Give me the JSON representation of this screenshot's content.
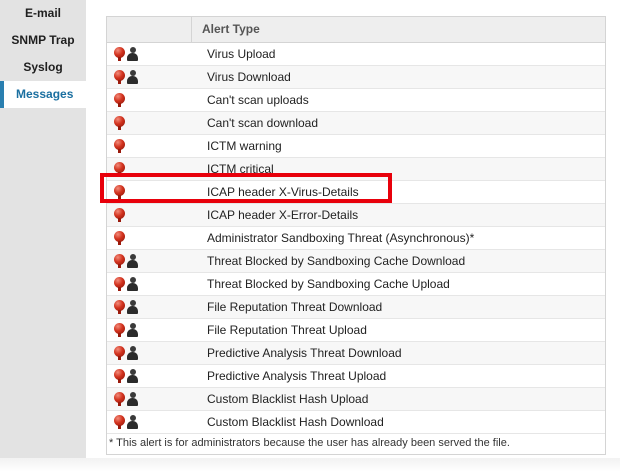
{
  "sidebar": {
    "items": [
      {
        "label": "E-mail",
        "active": false
      },
      {
        "label": "SNMP Trap",
        "active": false
      },
      {
        "label": "Syslog",
        "active": false
      },
      {
        "label": "Messages",
        "active": true
      }
    ]
  },
  "table": {
    "header": {
      "alert_type": "Alert Type"
    },
    "rows": [
      {
        "label": "Virus Upload",
        "icons": [
          "admin-icon",
          "user-icon"
        ]
      },
      {
        "label": "Virus Download",
        "icons": [
          "admin-icon",
          "user-icon"
        ]
      },
      {
        "label": "Can't scan uploads",
        "icons": [
          "admin-icon"
        ]
      },
      {
        "label": "Can't scan download",
        "icons": [
          "admin-icon"
        ]
      },
      {
        "label": "ICTM warning",
        "icons": [
          "admin-icon"
        ]
      },
      {
        "label": "ICTM critical",
        "icons": [
          "admin-icon"
        ]
      },
      {
        "label": "ICAP header X-Virus-Details",
        "icons": [
          "admin-icon"
        ],
        "highlighted": true
      },
      {
        "label": "ICAP header X-Error-Details",
        "icons": [
          "admin-icon"
        ]
      },
      {
        "label": "Administrator Sandboxing Threat (Asynchronous)*",
        "icons": [
          "admin-icon"
        ]
      },
      {
        "label": "Threat Blocked by Sandboxing Cache Download",
        "icons": [
          "admin-icon",
          "user-icon"
        ]
      },
      {
        "label": "Threat Blocked by Sandboxing Cache Upload",
        "icons": [
          "admin-icon",
          "user-icon"
        ]
      },
      {
        "label": "File Reputation Threat Download",
        "icons": [
          "admin-icon",
          "user-icon"
        ]
      },
      {
        "label": "File Reputation Threat Upload",
        "icons": [
          "admin-icon",
          "user-icon"
        ]
      },
      {
        "label": "Predictive Analysis Threat Download",
        "icons": [
          "admin-icon",
          "user-icon"
        ]
      },
      {
        "label": "Predictive Analysis Threat Upload",
        "icons": [
          "admin-icon",
          "user-icon"
        ]
      },
      {
        "label": "Custom Blacklist Hash Upload",
        "icons": [
          "admin-icon",
          "user-icon"
        ]
      },
      {
        "label": "Custom Blacklist Hash Download",
        "icons": [
          "admin-icon",
          "user-icon"
        ]
      }
    ],
    "footnote": "* This alert is for administrators because the user has already been served the file."
  },
  "colors": {
    "highlight": "#e8000b",
    "active_nav": "#1a6fa0",
    "sidebar_bg": "#e3e3e3"
  }
}
